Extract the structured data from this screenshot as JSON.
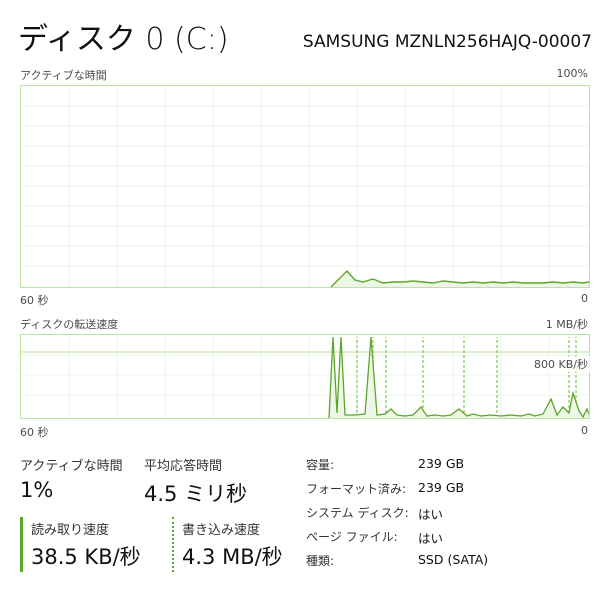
{
  "header": {
    "title": "ディスク 0 (C:)",
    "model": "SAMSUNG MZNLN256HAJQ-00007"
  },
  "graph_active": {
    "label": "アクティブな時間",
    "max_label": "100%",
    "time_label": "60 秒",
    "min_label": "0"
  },
  "graph_transfer": {
    "label": "ディスクの転送速度",
    "max_label": "1 MB/秒",
    "line_label": "800 KB/秒",
    "time_label": "60 秒",
    "min_label": "0"
  },
  "stats": {
    "active_time": {
      "label": "アクティブな時間",
      "value": "1%"
    },
    "response_time": {
      "label": "平均応答時間",
      "value": "4.5 ミリ秒"
    },
    "read_speed": {
      "label": "読み取り速度",
      "value": "38.5 KB/秒"
    },
    "write_speed": {
      "label": "書き込み速度",
      "value": "4.3 MB/秒"
    }
  },
  "properties": [
    {
      "label": "容量:",
      "value": "239 GB"
    },
    {
      "label": "フォーマット済み:",
      "value": "239 GB"
    },
    {
      "label": "システム ディスク:",
      "value": "はい"
    },
    {
      "label": "ページ ファイル:",
      "value": "はい"
    },
    {
      "label": "種類:",
      "value": "SSD (SATA)"
    }
  ],
  "colors": {
    "accent": "#5ca62a",
    "grid": "#e8f2df",
    "border": "#bde0a4"
  }
}
